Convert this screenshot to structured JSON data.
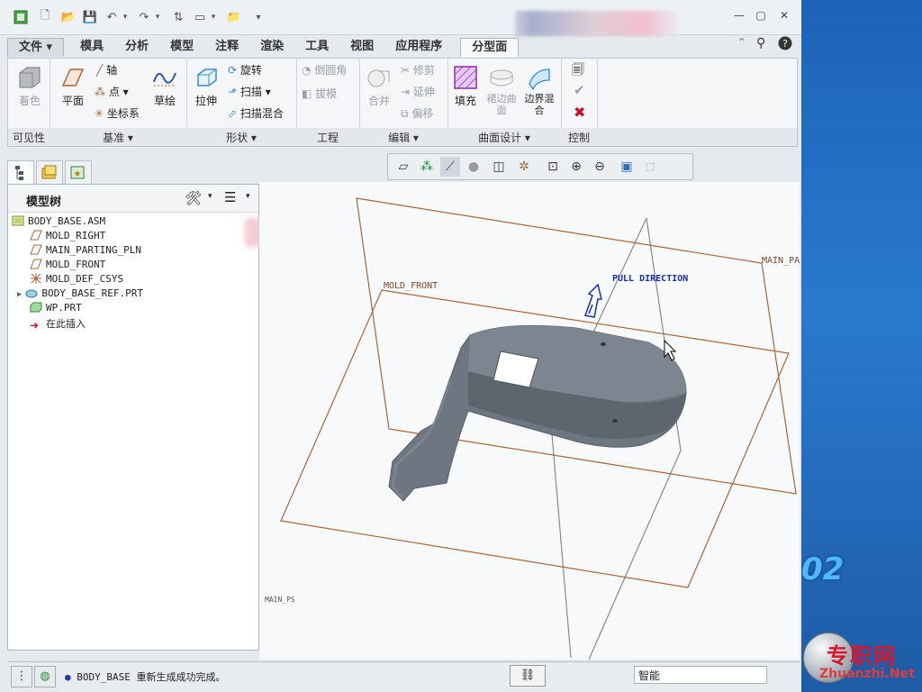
{
  "tabs": {
    "file": "文件",
    "items": [
      "模具",
      "分析",
      "模型",
      "注释",
      "渲染",
      "工具",
      "视图",
      "应用程序"
    ],
    "active": "分型面"
  },
  "ribbon": {
    "visibility": {
      "shading": "着色",
      "label": "可见性"
    },
    "datum": {
      "plane": "平面",
      "axis": "轴",
      "point": "点",
      "csys": "坐标系",
      "sketch": "草绘",
      "label": "基准"
    },
    "shape": {
      "extrude": "拉伸",
      "revolve": "旋转",
      "sweep": "扫描",
      "swept_blend": "扫描混合",
      "label": "形状"
    },
    "engineering": {
      "round": "倒圆角",
      "draft": "拔模",
      "label": "工程"
    },
    "editing": {
      "merge": "合并",
      "trim": "修剪",
      "extend": "延伸",
      "offset": "偏移",
      "label": "编辑"
    },
    "surface_design": {
      "fill": "填充",
      "skirt": "裙边曲面",
      "boundary_blend": "边界混合",
      "label": "曲面设计"
    },
    "control": {
      "label": "控制"
    }
  },
  "model_tree": {
    "title": "模型树",
    "items": [
      {
        "name": "BODY_BASE.ASM",
        "icon": "assembly-icon"
      },
      {
        "name": "MOLD_RIGHT",
        "icon": "datum-plane-icon"
      },
      {
        "name": "MAIN_PARTING_PLN",
        "icon": "datum-plane-icon"
      },
      {
        "name": "MOLD_FRONT",
        "icon": "datum-plane-icon"
      },
      {
        "name": "MOLD_DEF_CSYS",
        "icon": "csys-icon"
      },
      {
        "name": "BODY_BASE_REF.PRT",
        "icon": "part-icon"
      },
      {
        "name": "WP.PRT",
        "icon": "workpiece-icon"
      },
      {
        "name": "在此插入",
        "icon": "insert-here-arrow-icon"
      }
    ]
  },
  "viewport": {
    "labels": {
      "mold_front": "MOLD_FRONT",
      "main_pa": "MAIN_PA",
      "pull_direction": "PULL DIRECTION",
      "main_ps": "MAIN_PS"
    }
  },
  "status": {
    "message": "BODY_BASE 重新生成成功完成。",
    "filter": "智能"
  },
  "watermark": {
    "number": "02",
    "brand_cn": "专职网",
    "brand_en": "Zhuanzhi.Net"
  },
  "colors": {
    "datum_plane": "#a5673a",
    "part_body": "#6e7681",
    "pull_arrow": "#1a2eb0",
    "desktop": "#1c63b8"
  }
}
